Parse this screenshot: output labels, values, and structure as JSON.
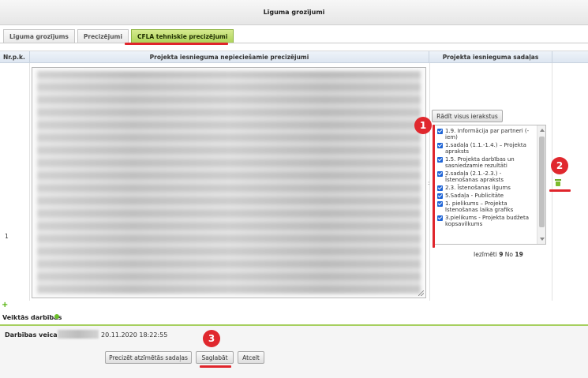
{
  "window": {
    "title": "Līguma grozījumi"
  },
  "tabs": [
    {
      "label": "Līguma grozījums",
      "active": false
    },
    {
      "label": "Precizējumi",
      "active": false
    },
    {
      "label": "CFLA tehniskie precizējumi",
      "active": true
    }
  ],
  "table": {
    "headers": [
      "Nr.p.k.",
      "Projekta iesnieguma nepieciešamie precizējumi",
      "Projekta iesnieguma sadaļas"
    ],
    "row_number": "1"
  },
  "sections": {
    "show_all_button": "Rādīt visus ierakstus",
    "items": [
      {
        "label": "1.9. Informācija par partneri (-iem)",
        "checked": true
      },
      {
        "label": "1.sadaļa (1.1.-1.4.) – Projekta apraksts",
        "checked": true
      },
      {
        "label": "1.5. Projekta darbības un sasniedzamie rezultāti",
        "checked": true
      },
      {
        "label": "2.sadaļa (2.1.-2.3.) - Īstenošanas apraksts",
        "checked": true
      },
      {
        "label": "2.3. Īstenošanas ilgums",
        "checked": true
      },
      {
        "label": "5.Sadaļa - Publicitāte",
        "checked": true
      },
      {
        "label": "1. pielikums – Projekta īstenošanas laika grafiks",
        "checked": true
      },
      {
        "label": "3.pielikums - Projekta budžeta kopsavilkums",
        "checked": true
      }
    ],
    "counter": {
      "prefix": "Iezīmēti",
      "selected": "9",
      "sep": "No",
      "total": "19"
    }
  },
  "annotations": [
    "1",
    "2",
    "3"
  ],
  "actions": {
    "plus": "+",
    "title": "Veiktās darbības",
    "performed_by_label": "Darbības veica",
    "performed_at": "20.11.2020 18:22:55"
  },
  "footer_buttons": {
    "clarify": "Precizēt atzīmētās sadaļas",
    "save": "Saglabāt",
    "cancel": "Atcelt"
  },
  "colors": {
    "accent_green": "#a6cf5f",
    "active_tab": "#aed45a",
    "annotation_red": "#e0282e",
    "checkbox_blue": "#1e64d6"
  }
}
